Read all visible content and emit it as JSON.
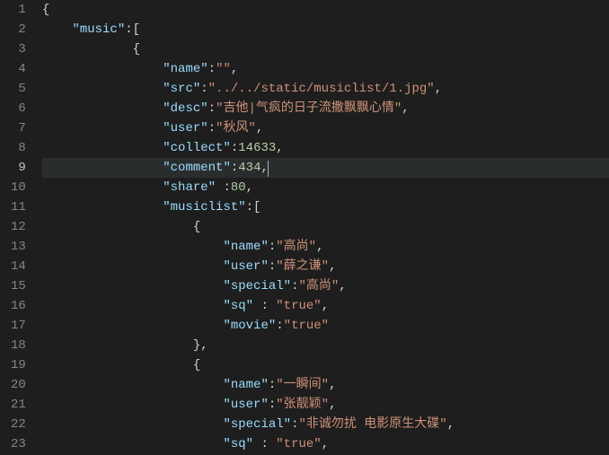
{
  "lineCount": 23,
  "activeLine": 9,
  "tokens": [
    [
      [
        "p",
        "{"
      ]
    ],
    [
      [
        "p",
        "    "
      ],
      [
        "k",
        "\"music\""
      ],
      [
        "p",
        ":["
      ]
    ],
    [
      [
        "p",
        "            {"
      ]
    ],
    [
      [
        "p",
        "                "
      ],
      [
        "k",
        "\"name\""
      ],
      [
        "p",
        ":"
      ],
      [
        "s",
        "\"\""
      ],
      [
        "p",
        ","
      ]
    ],
    [
      [
        "p",
        "                "
      ],
      [
        "k",
        "\"src\""
      ],
      [
        "p",
        ":"
      ],
      [
        "s",
        "\"../../static/musiclist/1.jpg\""
      ],
      [
        "p",
        ","
      ]
    ],
    [
      [
        "p",
        "                "
      ],
      [
        "k",
        "\"desc\""
      ],
      [
        "p",
        ":"
      ],
      [
        "s",
        "\"吉他|气疯的日子流撒飘飘心情\""
      ],
      [
        "p",
        ","
      ]
    ],
    [
      [
        "p",
        "                "
      ],
      [
        "k",
        "\"user\""
      ],
      [
        "p",
        ":"
      ],
      [
        "s",
        "\"秋风\""
      ],
      [
        "p",
        ","
      ]
    ],
    [
      [
        "p",
        "                "
      ],
      [
        "k",
        "\"collect\""
      ],
      [
        "p",
        ":"
      ],
      [
        "n",
        "14633"
      ],
      [
        "p",
        ","
      ]
    ],
    [
      [
        "p",
        "                "
      ],
      [
        "k",
        "\"comment\""
      ],
      [
        "p",
        ":"
      ],
      [
        "n",
        "434"
      ],
      [
        "p",
        ","
      ],
      [
        "cursor",
        ""
      ]
    ],
    [
      [
        "p",
        "                "
      ],
      [
        "k",
        "\"share\""
      ],
      [
        "p",
        " :"
      ],
      [
        "n",
        "80"
      ],
      [
        "p",
        ","
      ]
    ],
    [
      [
        "p",
        "                "
      ],
      [
        "k",
        "\"musiclist\""
      ],
      [
        "p",
        ":["
      ]
    ],
    [
      [
        "p",
        "                    {"
      ]
    ],
    [
      [
        "p",
        "                        "
      ],
      [
        "k",
        "\"name\""
      ],
      [
        "p",
        ":"
      ],
      [
        "s",
        "\"高尚\""
      ],
      [
        "p",
        ","
      ]
    ],
    [
      [
        "p",
        "                        "
      ],
      [
        "k",
        "\"user\""
      ],
      [
        "p",
        ":"
      ],
      [
        "s",
        "\"薛之谦\""
      ],
      [
        "p",
        ","
      ]
    ],
    [
      [
        "p",
        "                        "
      ],
      [
        "k",
        "\"special\""
      ],
      [
        "p",
        ":"
      ],
      [
        "s",
        "\"高尚\""
      ],
      [
        "p",
        ","
      ]
    ],
    [
      [
        "p",
        "                        "
      ],
      [
        "k",
        "\"sq\""
      ],
      [
        "p",
        " : "
      ],
      [
        "s",
        "\"true\""
      ],
      [
        "p",
        ","
      ]
    ],
    [
      [
        "p",
        "                        "
      ],
      [
        "k",
        "\"movie\""
      ],
      [
        "p",
        ":"
      ],
      [
        "s",
        "\"true\""
      ]
    ],
    [
      [
        "p",
        "                    },"
      ]
    ],
    [
      [
        "p",
        "                    {"
      ]
    ],
    [
      [
        "p",
        "                        "
      ],
      [
        "k",
        "\"name\""
      ],
      [
        "p",
        ":"
      ],
      [
        "s",
        "\"一瞬间\""
      ],
      [
        "p",
        ","
      ]
    ],
    [
      [
        "p",
        "                        "
      ],
      [
        "k",
        "\"user\""
      ],
      [
        "p",
        ":"
      ],
      [
        "s",
        "\"张靓颖\""
      ],
      [
        "p",
        ","
      ]
    ],
    [
      [
        "p",
        "                        "
      ],
      [
        "k",
        "\"special\""
      ],
      [
        "p",
        ":"
      ],
      [
        "s",
        "\"非诚勿扰 电影原生大碟\""
      ],
      [
        "p",
        ","
      ]
    ],
    [
      [
        "p",
        "                        "
      ],
      [
        "k",
        "\"sq\""
      ],
      [
        "p",
        " : "
      ],
      [
        "s",
        "\"true\""
      ],
      [
        "p",
        ","
      ]
    ]
  ]
}
